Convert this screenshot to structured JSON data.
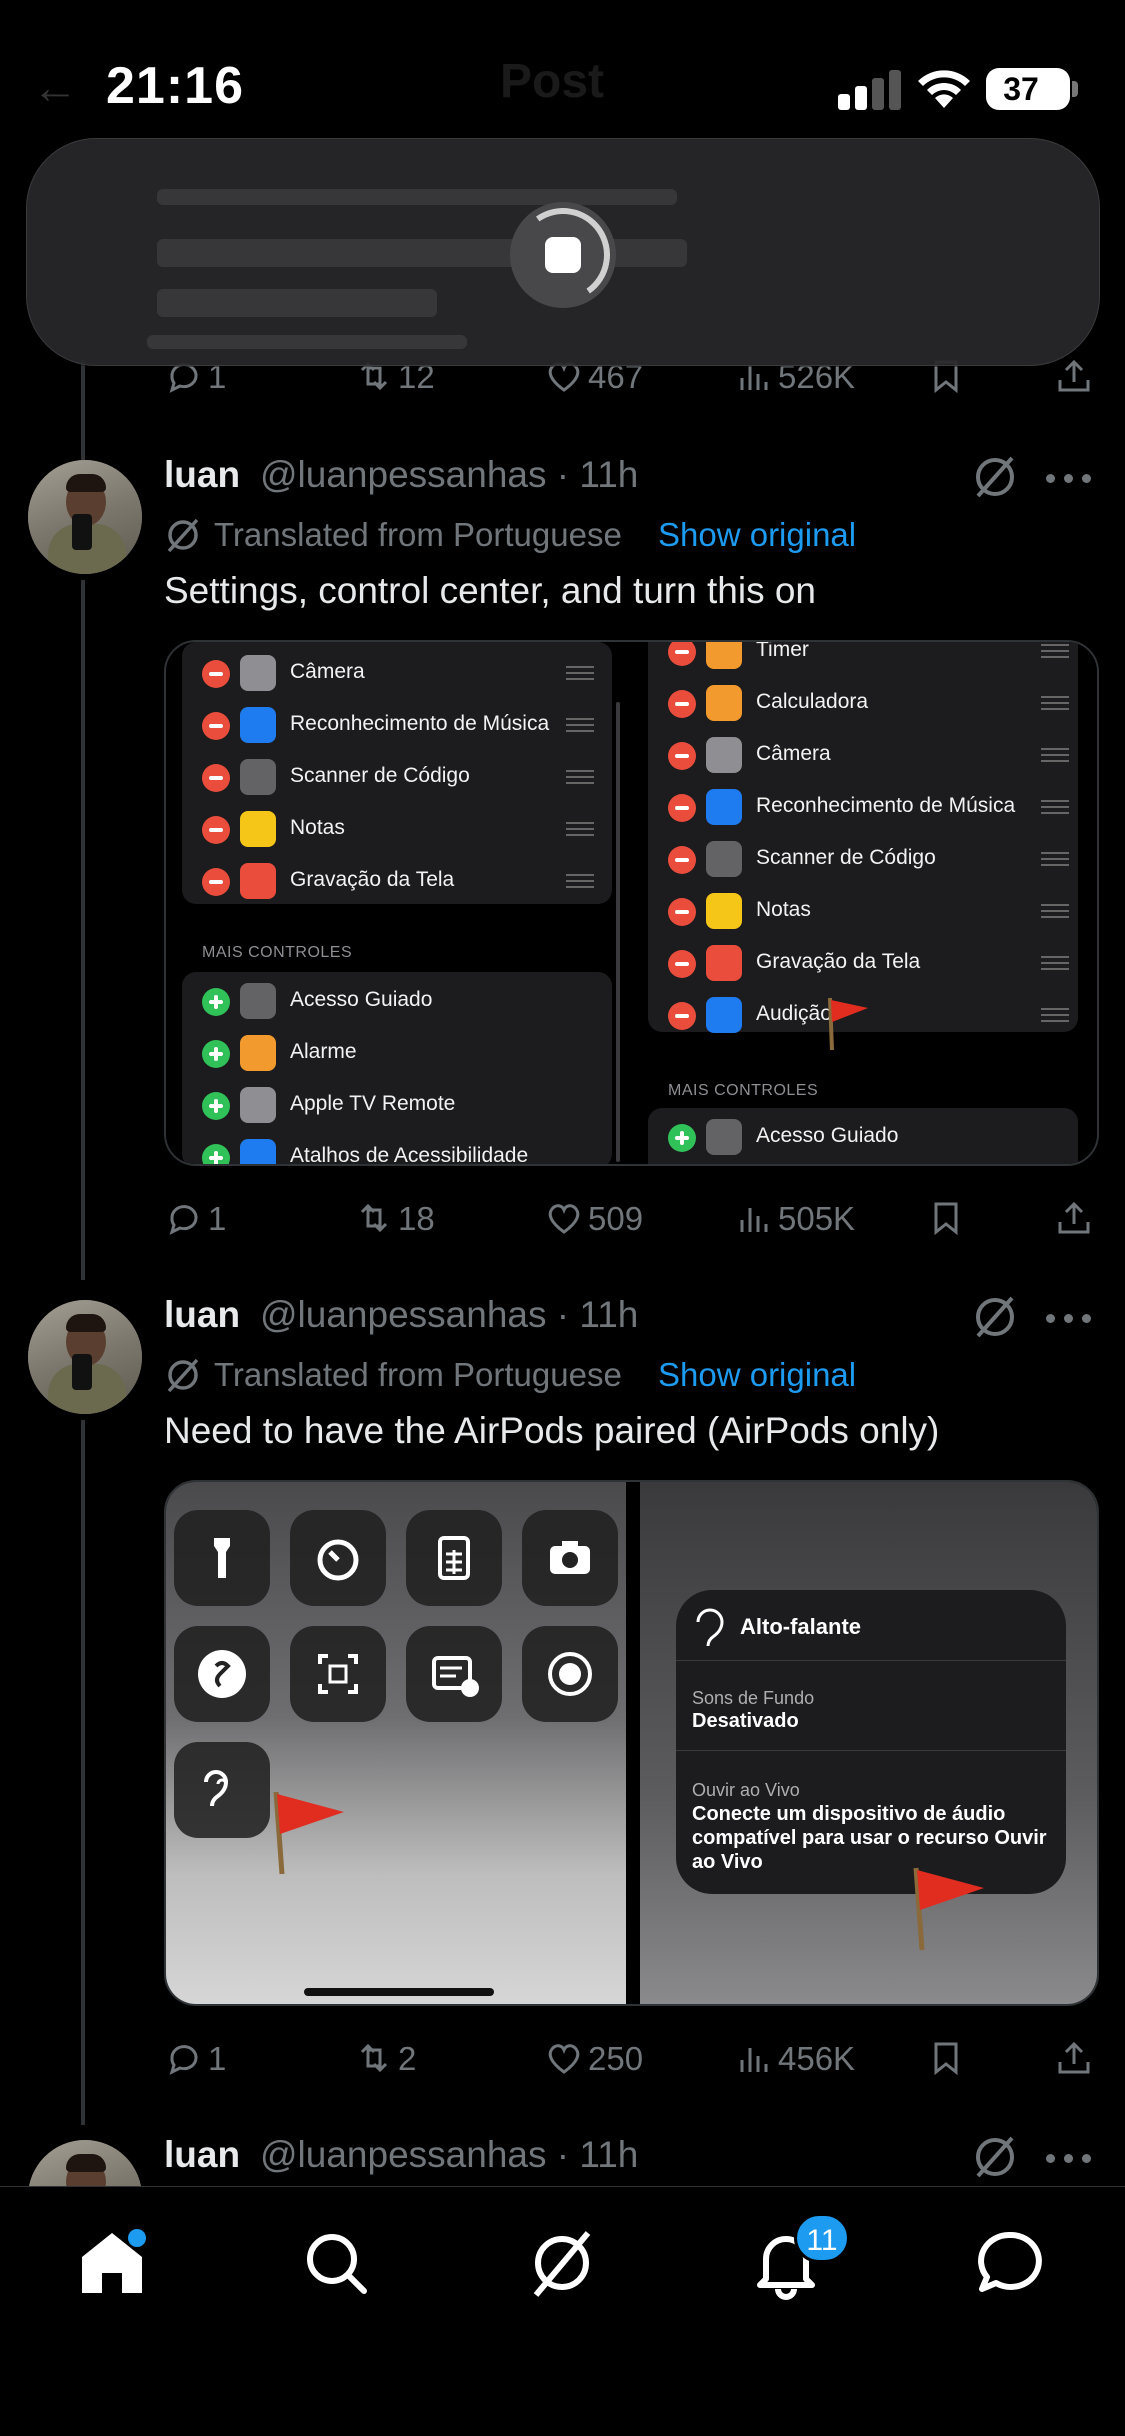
{
  "status_bar": {
    "time": "21:16",
    "battery": "37"
  },
  "header": {
    "title": "Post"
  },
  "tweets": [
    {
      "name": "luan",
      "handle": "@luanpessanhas · 11h",
      "translated_label": "Translated from Portuguese",
      "show_original": "Show original",
      "text": "Settings, control center, and turn this on",
      "media": {
        "left_rows": [
          "Câmera",
          "Reconhecimento de Música",
          "Scanner de Código",
          "Notas",
          "Gravação da Tela"
        ],
        "left_section": "MAIS CONTROLES",
        "left_more": [
          "Acesso Guiado",
          "Alarme",
          "Apple TV Remote",
          "Atalhos de Acessibilidade"
        ],
        "right_rows": [
          "Timer",
          "Calculadora",
          "Câmera",
          "Reconhecimento de Música",
          "Scanner de Código",
          "Notas",
          "Gravação da Tela",
          "Audição"
        ],
        "right_section": "MAIS CONTROLES",
        "right_more": [
          "Acesso Guiado"
        ]
      },
      "stats": {
        "replies": "1",
        "reposts": "18",
        "likes": "509",
        "views": "505K"
      }
    },
    {
      "name": "luan",
      "handle": "@luanpessanhas · 11h",
      "translated_label": "Translated from Portuguese",
      "show_original": "Show original",
      "text": "Need to have the AirPods paired (AirPods only)",
      "media": {
        "panel_title": "Alto-falante",
        "item1_label": "Sons de Fundo",
        "item1_value": "Desativado",
        "item2_label": "Ouvir ao Vivo",
        "item2_value": "Conecte um dispositivo de áudio compatível para usar o recurso Ouvir ao Vivo"
      },
      "stats": {
        "replies": "1",
        "reposts": "2",
        "likes": "250",
        "views": "456K"
      }
    },
    {
      "name": "luan",
      "handle": "@luanpessanhas · 11h"
    }
  ],
  "previous_tweet_stats": {
    "replies": "1",
    "reposts": "12",
    "likes": "467",
    "views": "526K"
  },
  "nav": {
    "notifications_badge": "11"
  },
  "colors": {
    "accent": "#1d9bf0",
    "background": "#000000",
    "muted": "#71767b",
    "text": "#e7e9ea"
  }
}
